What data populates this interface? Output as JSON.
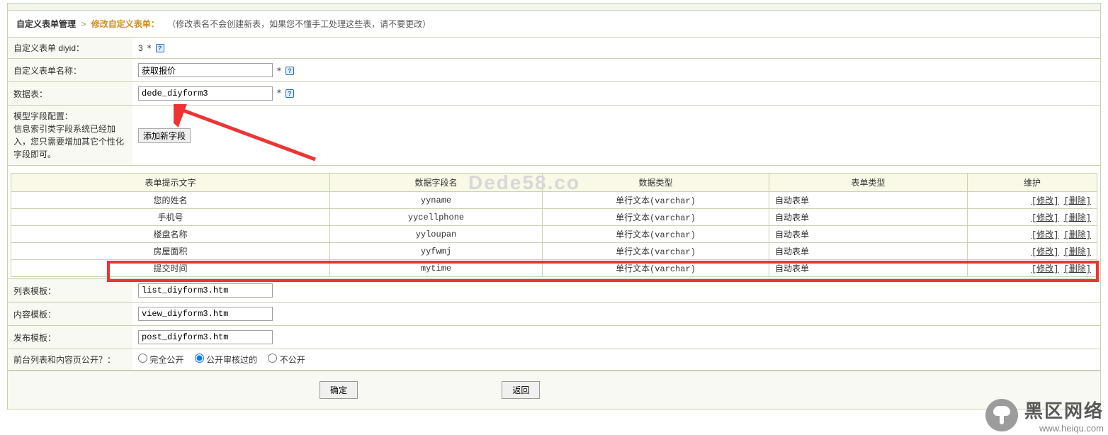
{
  "breadcrumb": {
    "mgmt": "自定义表单管理",
    "current": "修改自定义表单：",
    "hint": "（修改表名不会创建新表，如果您不懂手工处理这些表，请不要更改）"
  },
  "formRows": {
    "diyid": {
      "label": "自定义表单 diyid：",
      "value": "3",
      "req": "*"
    },
    "name": {
      "label": "自定义表单名称：",
      "value": "获取报价",
      "req": "*"
    },
    "table": {
      "label": "数据表：",
      "value": "dede_diyform3",
      "req": "*"
    },
    "fieldcfg": {
      "label": "模型字段配置：\n信息索引类字段系统已经加入，您只需要增加其它个性化字段即可。",
      "addBtn": "添加新字段"
    },
    "listtpl": {
      "label": "列表模板：",
      "value": "list_diyform3.htm"
    },
    "viewtpl": {
      "label": "内容模板：",
      "value": "view_diyform3.htm"
    },
    "posttpl": {
      "label": "发布模板：",
      "value": "post_diyform3.htm"
    },
    "public": {
      "label": "前台列表和内容页公开？：",
      "opt1": "完全公开",
      "opt2": "公开审核过的",
      "opt3": "不公开"
    }
  },
  "fieldTable": {
    "headers": {
      "c1": "表单提示文字",
      "c2": "数据字段名",
      "c3": "数据类型",
      "c4": "表单类型",
      "c5": "维护"
    },
    "rows": [
      {
        "c1": "您的姓名",
        "c2": "yyname",
        "c3": "单行文本(varchar)",
        "c4": "自动表单",
        "edit": "[修改]",
        "del": "[删除]"
      },
      {
        "c1": "手机号",
        "c2": "yycellphone",
        "c3": "单行文本(varchar)",
        "c4": "自动表单",
        "edit": "[修改]",
        "del": "[删除]"
      },
      {
        "c1": "楼盘名称",
        "c2": "yyloupan",
        "c3": "单行文本(varchar)",
        "c4": "自动表单",
        "edit": "[修改]",
        "del": "[删除]"
      },
      {
        "c1": "房屋面积",
        "c2": "yyfwmj",
        "c3": "单行文本(varchar)",
        "c4": "自动表单",
        "edit": "[修改]",
        "del": "[删除]"
      },
      {
        "c1": "提交时间",
        "c2": "mytime",
        "c3": "单行文本(varchar)",
        "c4": "自动表单",
        "edit": "[修改]",
        "del": "[删除]"
      }
    ]
  },
  "buttons": {
    "ok": "确定",
    "back": "返回"
  },
  "watermark": "Dede58.co",
  "brand": {
    "title": "黑区网络",
    "url": "www.heiqu.com"
  }
}
